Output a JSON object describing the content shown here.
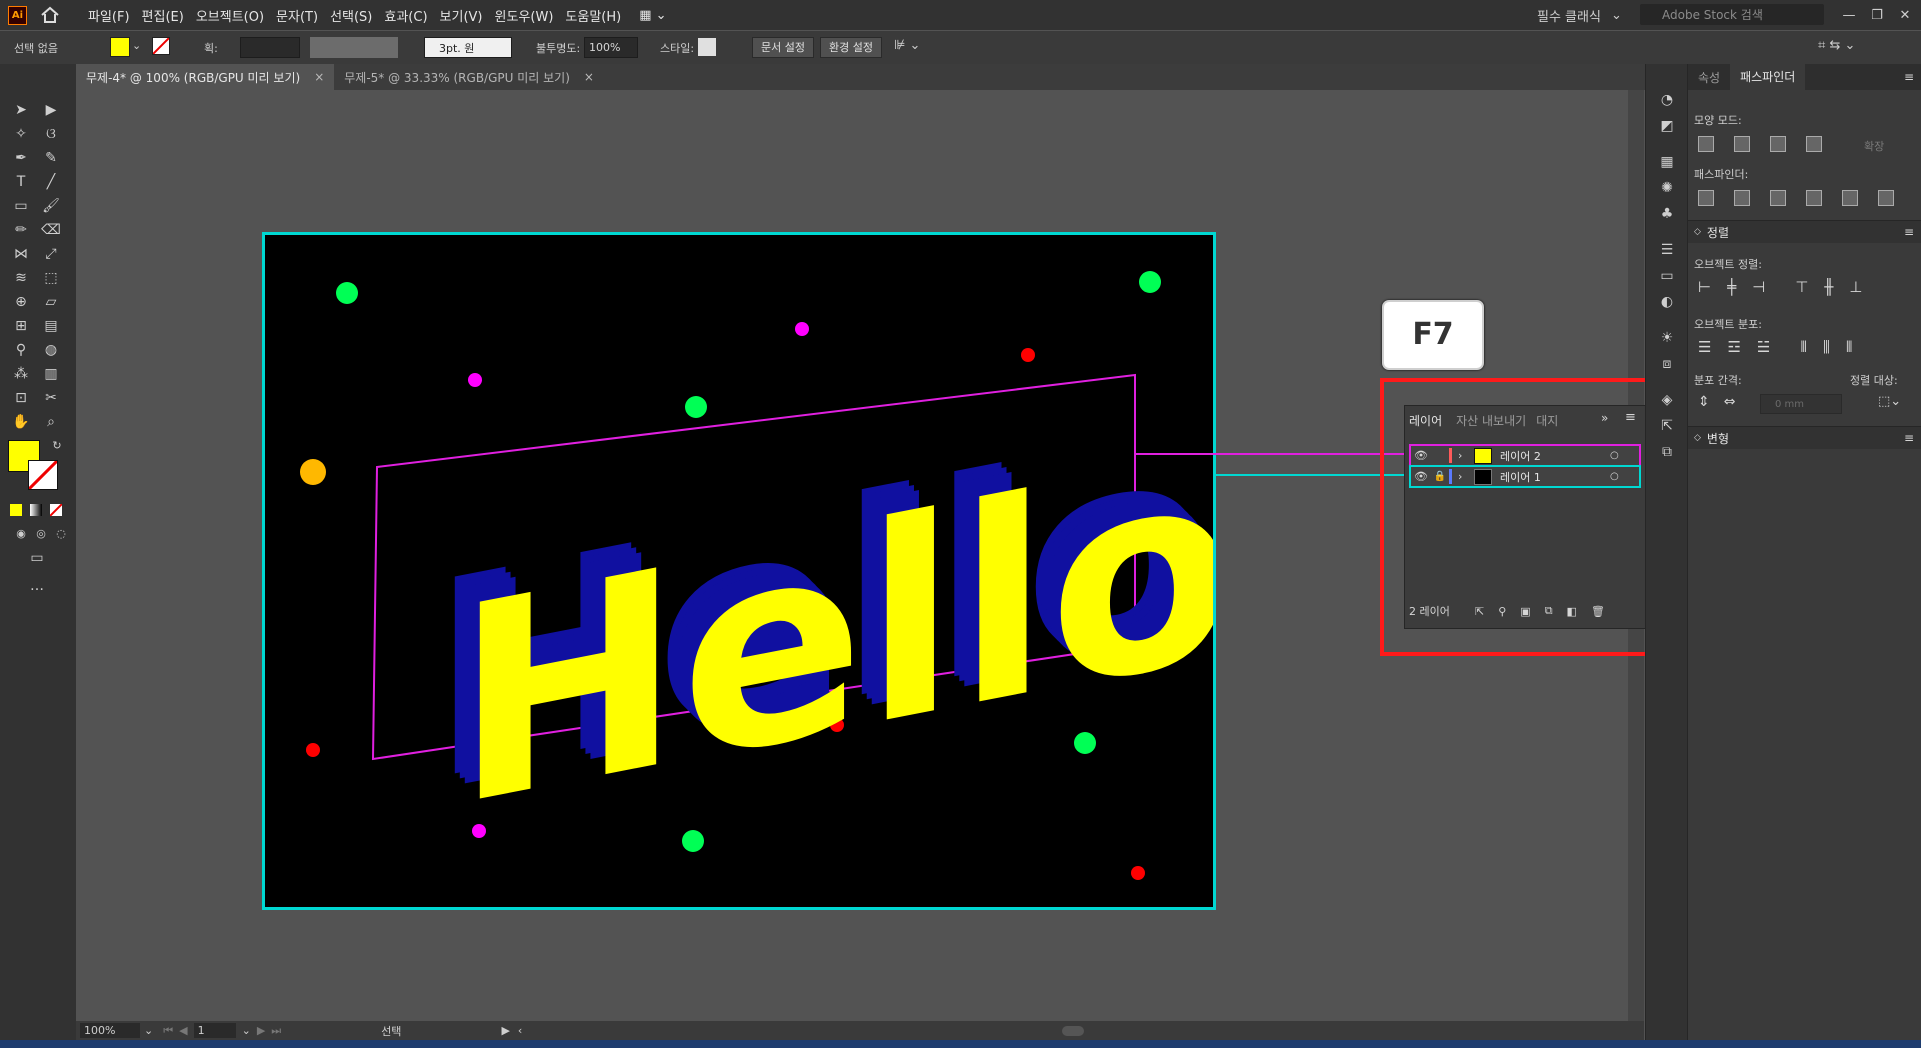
{
  "app": {
    "logo": "Ai"
  },
  "menubar": {
    "items": [
      "파일(F)",
      "편집(E)",
      "오브젝트(O)",
      "문자(T)",
      "선택(S)",
      "효과(C)",
      "보기(V)",
      "윈도우(W)",
      "도움말(H)"
    ],
    "workspace": "필수 클래식",
    "stock_placeholder": "Adobe Stock 검색"
  },
  "controlbar": {
    "selection": "선택 없음",
    "stroke_label": "획:",
    "brush": "3pt. 원",
    "opacity_label": "불투명도:",
    "opacity": "100%",
    "style_label": "스타일:",
    "doc_setup": "문서 설정",
    "preferences": "환경 설정"
  },
  "tabs": [
    {
      "label": "무제-4* @ 100% (RGB/GPU 미리 보기)",
      "close": "×"
    },
    {
      "label": "무제-5* @ 33.33% (RGB/GPU 미리 보기)",
      "close": "×"
    }
  ],
  "colors": {
    "fill": "#ffff00",
    "artboard_border": "#00d8d2",
    "callout_red": "#ff1a1a",
    "magenta": "#e020e0",
    "text_yellow": "#ffff00",
    "extrude_blue": "#1010a0"
  },
  "artwork": {
    "text": "Hello"
  },
  "callout": {
    "key": "F7"
  },
  "layers_panel": {
    "tabs": [
      "레이어",
      "자산 내보내기",
      "대지"
    ],
    "layers": [
      {
        "name": "레이어 2"
      },
      {
        "name": "레이어 1"
      }
    ],
    "count": "2 레이어"
  },
  "right_panel": {
    "tabs": [
      "속성",
      "패스파인더"
    ],
    "shape_modes": "모양 모드:",
    "expand": "확장",
    "pathfinders": "패스파인더:",
    "align_title": "정렬",
    "align_objects": "오브젝트 정렬:",
    "distribute_objects": "오브젝트 분포:",
    "distribute_spacing": "분포 간격:",
    "align_to": "정렬 대상:",
    "spacing_value": "0 mm",
    "transform_title": "변형"
  },
  "statusbar": {
    "zoom": "100%",
    "page": "1",
    "tool": "선택"
  }
}
